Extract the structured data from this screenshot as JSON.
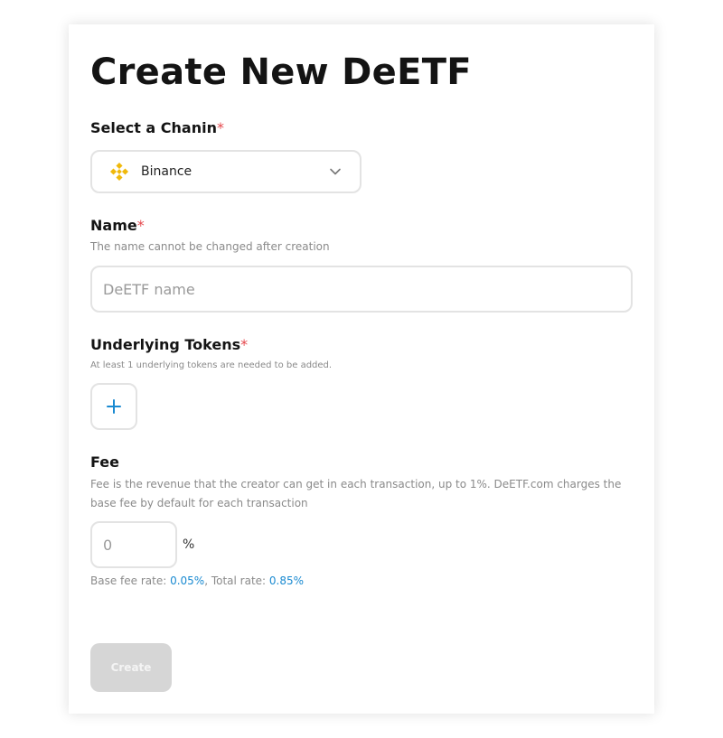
{
  "page": {
    "title": "Create New DeETF"
  },
  "chain": {
    "label": "Select a Chanin",
    "required_mark": "*",
    "selected": "Binance",
    "coin_icon": "binance-icon",
    "coin_color": "#F0B90B"
  },
  "name": {
    "label": "Name",
    "required_mark": "*",
    "hint": "The name cannot be changed after creation",
    "placeholder": "DeETF name",
    "value": ""
  },
  "tokens": {
    "label": "Underlying Tokens",
    "required_mark": "*",
    "hint": "At least 1 underlying tokens are needed to be added.",
    "add_icon": "plus-icon",
    "accent": "#1a8ad1"
  },
  "fee": {
    "label": "Fee",
    "hint_line1": "Fee is the revenue that the creator can get in each transaction, up to 1%. DeETF.com charges the",
    "hint_line2": "base fee by default for each transaction",
    "placeholder": "0",
    "value": "",
    "unit": "%",
    "base_label": "Base fee rate: ",
    "base_value": "0.05%",
    "separator": ", ",
    "total_label": "Total rate: ",
    "total_value": "0.85%"
  },
  "actions": {
    "create_label": "Create"
  }
}
